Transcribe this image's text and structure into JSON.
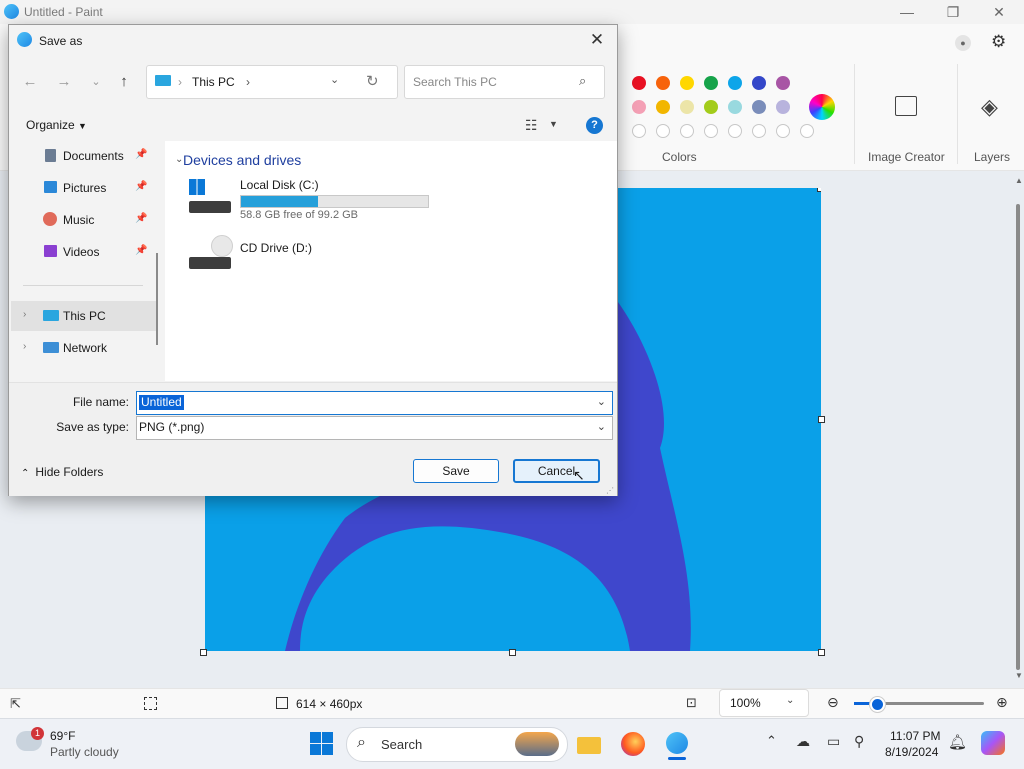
{
  "paint": {
    "title": "Untitled - Paint",
    "window_controls": {
      "minimize": "—",
      "maximize": "❐",
      "close": "✕"
    },
    "ribbon": {
      "colors_label": "Colors",
      "image_creator_label": "Image Creator",
      "layers_label": "Layers",
      "swatches_row1": [
        "#e81123",
        "#f7630c",
        "#ffd700",
        "#16a34a",
        "#0ea5e9",
        "#3447c9",
        "#a855a5"
      ],
      "swatches_row2": [
        "#f4a0b5",
        "#f2b600",
        "#ece5a8",
        "#a3cc1b",
        "#99d9df",
        "#7a8dba",
        "#b8b3dd"
      ]
    },
    "status": {
      "canvas_size": "614 × 460px",
      "zoom": "100%"
    },
    "canvas_color": "#0aa0e8",
    "shape_color": "#3f47cc"
  },
  "dialog": {
    "title": "Save as",
    "address": {
      "location": "This PC",
      "separator": "›"
    },
    "search_placeholder": "Search This PC",
    "organize_label": "Organize",
    "nav": [
      {
        "label": "Documents",
        "pinned": true
      },
      {
        "label": "Pictures",
        "pinned": true
      },
      {
        "label": "Music",
        "pinned": true
      },
      {
        "label": "Videos",
        "pinned": true
      },
      {
        "label": "This PC",
        "pinned": false
      },
      {
        "label": "Network",
        "pinned": false
      }
    ],
    "section_header": "Devices and drives",
    "drives": [
      {
        "name": "Local Disk (C:)",
        "detail": "58.8 GB free of 99.2 GB",
        "used_fraction": 0.41
      },
      {
        "name": "CD Drive (D:)"
      }
    ],
    "filename_label": "File name:",
    "filename_value": "Untitled",
    "savetype_label": "Save as type:",
    "savetype_value": "PNG (*.png)",
    "save_button": "Save",
    "cancel_button": "Cancel",
    "hide_folders": "Hide Folders"
  },
  "taskbar": {
    "weather_temp": "69°F",
    "weather_desc": "Partly cloudy",
    "weather_badge": "1",
    "search_label": "Search",
    "time": "11:07 PM",
    "date": "8/19/2024"
  }
}
